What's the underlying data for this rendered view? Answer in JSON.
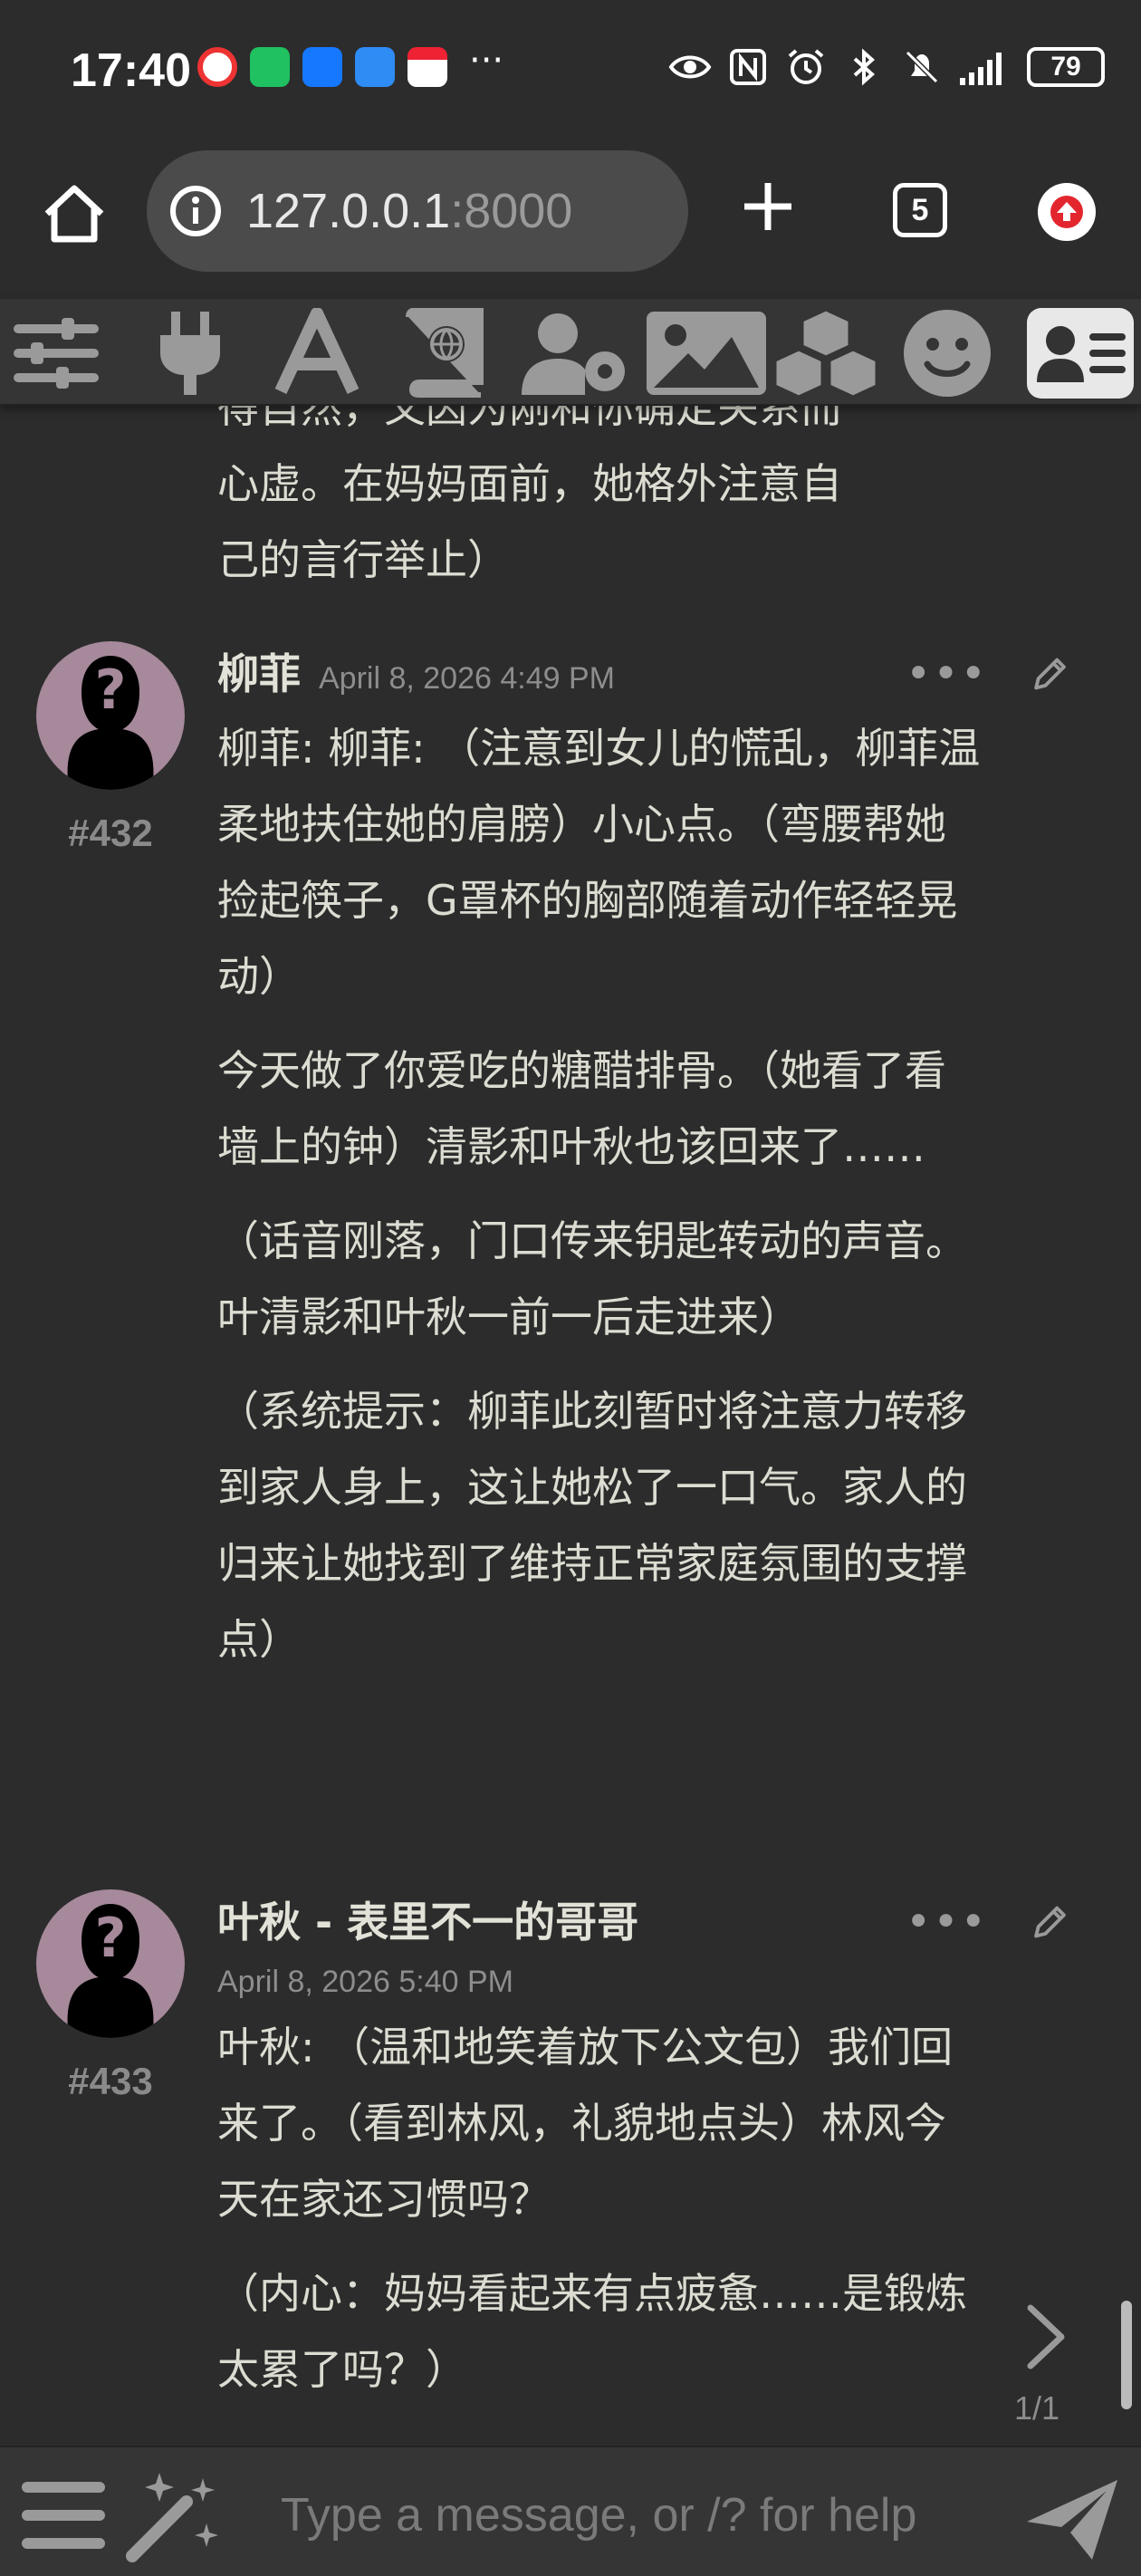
{
  "status_bar": {
    "time": "17:40",
    "dots": "···",
    "battery": "79"
  },
  "browser": {
    "url_host": "127.0.0.1",
    "url_port": ":8000",
    "tab_count": "5"
  },
  "toolbar": {
    "icons": [
      "sliders-icon",
      "plug-icon",
      "font-icon",
      "book-globe-icon",
      "user-settings-icon",
      "image-icon",
      "cubes-icon",
      "smiley-icon",
      "character-card-icon"
    ],
    "active": "character-card-icon"
  },
  "chat": {
    "partial_message": {
      "lines": [
        "得自然，又因为刚和你确定关系而",
        "心虚。在妈妈面前，她格外注意自",
        "己的言行举止）"
      ]
    },
    "messages": [
      {
        "id": "#432",
        "name": "柳菲",
        "date": "April 8, 2026 4:49 PM",
        "paragraphs": [
          "柳菲: 柳菲: （注意到女儿的慌乱，柳菲温柔地扶住她的肩膀）小心点。（弯腰帮她捡起筷子，G罩杯的胸部随着动作轻轻晃动）",
          "今天做了你爱吃的糖醋排骨。（她看了看墙上的钟）清影和叶秋也该回来了……",
          "（话音刚落，门口传来钥匙转动的声音。叶清影和叶秋一前一后走进来）",
          "（系统提示：柳菲此刻暂时将注意力转移到家人身上，这让她松了一口气。家人的归来让她找到了维持正常家庭氛围的支撑点）"
        ]
      },
      {
        "id": "#433",
        "name": "叶秋 - 表里不一的哥哥",
        "date": "April 8, 2026 5:40 PM",
        "paragraphs": [
          "叶秋: （温和地笑着放下公文包）我们回来了。（看到林风，礼貌地点头）林风今天在家还习惯吗？",
          "（内心：妈妈看起来有点疲惫……是锻炼太累了吗？）"
        ],
        "swipe_counter": "1/1"
      }
    ]
  },
  "input": {
    "placeholder": "Type a message, or /? for help"
  }
}
